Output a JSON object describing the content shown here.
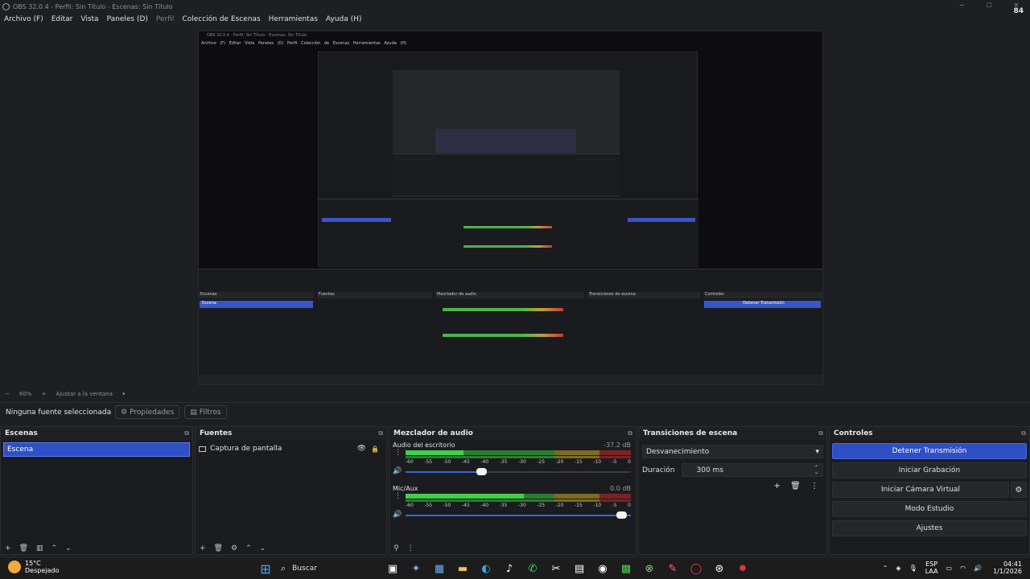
{
  "window": {
    "title": "OBS 32.0.4 - Perfil: Sin Título - Escenas: Sin Título",
    "badge": "84"
  },
  "menu": {
    "items": [
      "Archivo (F)",
      "Editar",
      "Vista",
      "Paneles (D)",
      "Perfil",
      "Colección de Escenas",
      "Herramientas",
      "Ayuda (H)"
    ]
  },
  "zoom": {
    "level": "60%",
    "fit": "Ajustar a la ventana"
  },
  "context": {
    "no_source": "Ninguna fuente seleccionada",
    "properties": "Propiedades",
    "filters": "Filtros"
  },
  "scenes": {
    "title": "Escenas",
    "items": [
      "Escena"
    ]
  },
  "sources": {
    "title": "Fuentes",
    "items": [
      "Captura de pantalla"
    ]
  },
  "mixer": {
    "title": "Mezclador de audio",
    "ticks": [
      "-60",
      "-55",
      "-50",
      "-45",
      "-40",
      "-35",
      "-30",
      "-25",
      "-20",
      "-15",
      "-10",
      "-5",
      "0"
    ],
    "channels": [
      {
        "name": "Audio del escritorio",
        "db": "-37.2 dB",
        "level": 0.26,
        "volume": 0.35
      },
      {
        "name": "Mic/Aux",
        "db": "0.0 dB",
        "level": 0.53,
        "volume": 1.0
      }
    ]
  },
  "transitions": {
    "title": "Transiciones de escena",
    "selected": "Desvanecimiento",
    "duration_label": "Duración",
    "duration_value": "300 ms"
  },
  "controls": {
    "title": "Controles",
    "stop_stream": "Detener Transmisión",
    "start_recording": "Iniciar Grabación",
    "start_virtual_cam": "Iniciar Cámara Virtual",
    "studio_mode": "Modo Estudio",
    "settings": "Ajustes"
  },
  "taskbar": {
    "temp": "15°C",
    "weather": "Despejado",
    "search": "Buscar",
    "lang_top": "ESP",
    "lang_bottom": "LAA",
    "time": "04:41",
    "date": "1/1/2026"
  },
  "colors": {
    "accent": "#2f4fc4",
    "meter_green": "#3fd04a",
    "meter_yellow": "#7c6b21",
    "meter_red": "#7b2323"
  }
}
